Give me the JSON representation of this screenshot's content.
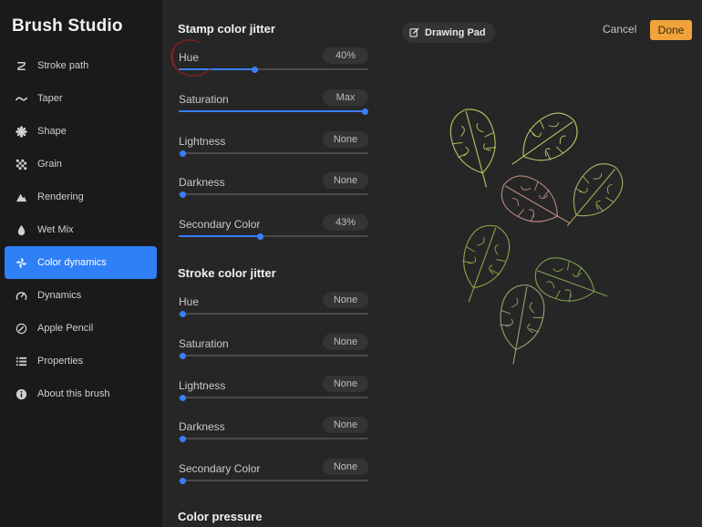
{
  "app": {
    "title": "Brush Studio"
  },
  "sidebar": {
    "items": [
      {
        "label": "Stroke path",
        "icon": "stroke-path-icon",
        "active": false
      },
      {
        "label": "Taper",
        "icon": "taper-icon",
        "active": false
      },
      {
        "label": "Shape",
        "icon": "shape-icon",
        "active": false
      },
      {
        "label": "Grain",
        "icon": "grain-icon",
        "active": false
      },
      {
        "label": "Rendering",
        "icon": "rendering-icon",
        "active": false
      },
      {
        "label": "Wet Mix",
        "icon": "wet-mix-icon",
        "active": false
      },
      {
        "label": "Color dynamics",
        "icon": "color-dynamics-icon",
        "active": true
      },
      {
        "label": "Dynamics",
        "icon": "dynamics-icon",
        "active": false
      },
      {
        "label": "Apple Pencil",
        "icon": "apple-pencil-icon",
        "active": false
      },
      {
        "label": "Properties",
        "icon": "properties-icon",
        "active": false
      },
      {
        "label": "About this brush",
        "icon": "info-icon",
        "active": false
      }
    ]
  },
  "panel": {
    "stamp_title": "Stamp color jitter",
    "stamp": [
      {
        "label": "Hue",
        "value": "40%",
        "level": 0.4
      },
      {
        "label": "Saturation",
        "value": "Max",
        "level": 1.0
      },
      {
        "label": "Lightness",
        "value": "None",
        "level": 0.0
      },
      {
        "label": "Darkness",
        "value": "None",
        "level": 0.0
      },
      {
        "label": "Secondary Color",
        "value": "43%",
        "level": 0.43
      }
    ],
    "stroke_title": "Stroke color jitter",
    "stroke": [
      {
        "label": "Hue",
        "value": "None",
        "level": 0.0
      },
      {
        "label": "Saturation",
        "value": "None",
        "level": 0.0
      },
      {
        "label": "Lightness",
        "value": "None",
        "level": 0.0
      },
      {
        "label": "Darkness",
        "value": "None",
        "level": 0.0
      },
      {
        "label": "Secondary Color",
        "value": "None",
        "level": 0.0
      }
    ],
    "pressure_title": "Color pressure"
  },
  "pad": {
    "title": "Drawing Pad",
    "cancel_label": "Cancel",
    "done_label": "Done"
  },
  "colors": {
    "accent": "#3a7dff",
    "done": "#f1a33a",
    "leaf_green": "#a9bf5a",
    "leaf_olive": "#8f9a45",
    "leaf_pink": "#b98a80",
    "scribble": "#8a1f22"
  }
}
